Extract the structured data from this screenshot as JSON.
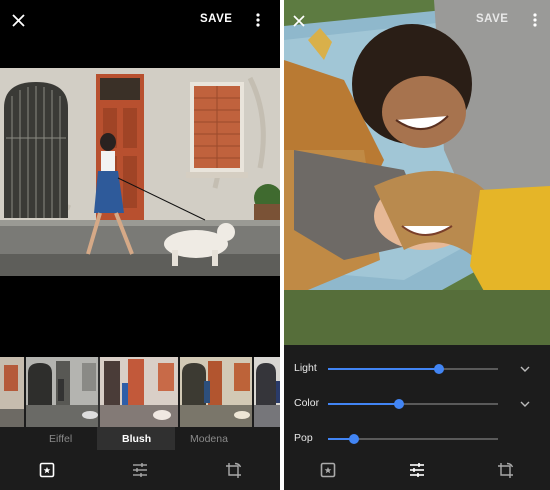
{
  "left_screen": {
    "toolbar": {
      "save_label": "SAVE"
    },
    "filters": [
      {
        "label": "Eiffel",
        "selected": false
      },
      {
        "label": "Blush",
        "selected": true
      },
      {
        "label": "Modena",
        "selected": false
      }
    ],
    "nav": [
      "filters-icon",
      "adjust-icon",
      "crop-rotate-icon"
    ],
    "active_tab": "filters"
  },
  "right_screen": {
    "toolbar": {
      "save_label": "SAVE"
    },
    "adjustments": [
      {
        "label": "Light",
        "value": 0.65,
        "expandable": true
      },
      {
        "label": "Color",
        "value": 0.42,
        "expandable": true
      },
      {
        "label": "Pop",
        "value": 0.15,
        "expandable": false
      }
    ],
    "nav": [
      "filters-icon",
      "adjust-icon",
      "crop-rotate-icon"
    ],
    "active_tab": "adjust"
  },
  "colors": {
    "accent": "#4285f4",
    "panel": "#1c1c1c",
    "background": "#000000"
  }
}
